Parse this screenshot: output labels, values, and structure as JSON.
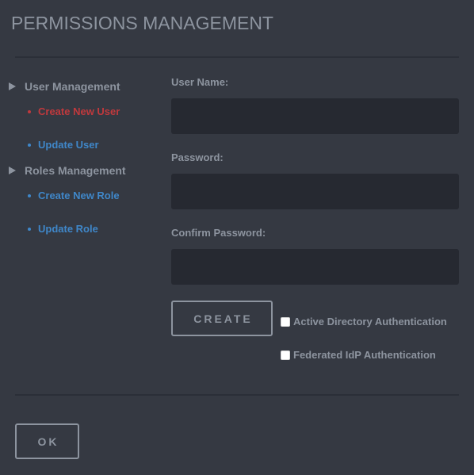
{
  "page": {
    "title": "PERMISSIONS MANAGEMENT"
  },
  "sidebar": {
    "sections": [
      {
        "label": "User Management",
        "icon": "triangle-right-icon",
        "items": [
          {
            "label": "Create New User",
            "state": "active"
          },
          {
            "label": "Update User",
            "state": "link"
          }
        ]
      },
      {
        "label": "Roles Management",
        "icon": "triangle-right-icon",
        "items": [
          {
            "label": "Create New Role",
            "state": "link"
          },
          {
            "label": "Update Role",
            "state": "link"
          }
        ]
      }
    ]
  },
  "form": {
    "username": {
      "label": "User Name:",
      "value": "",
      "placeholder": ""
    },
    "password": {
      "label": "Password:",
      "value": "",
      "placeholder": ""
    },
    "confirm_password": {
      "label": "Confirm Password:",
      "value": "",
      "placeholder": ""
    },
    "create_label": "CREATE",
    "options": [
      {
        "label": "Active Directory Authentication",
        "checked": false
      },
      {
        "label": "Federated IdP Authentication",
        "checked": false
      }
    ]
  },
  "footer": {
    "ok_label": "OK"
  },
  "colors": {
    "background": "#353942",
    "input_bg": "#262931",
    "text_muted": "#8d949f",
    "active": "#c0393d",
    "link": "#3f87c9"
  }
}
